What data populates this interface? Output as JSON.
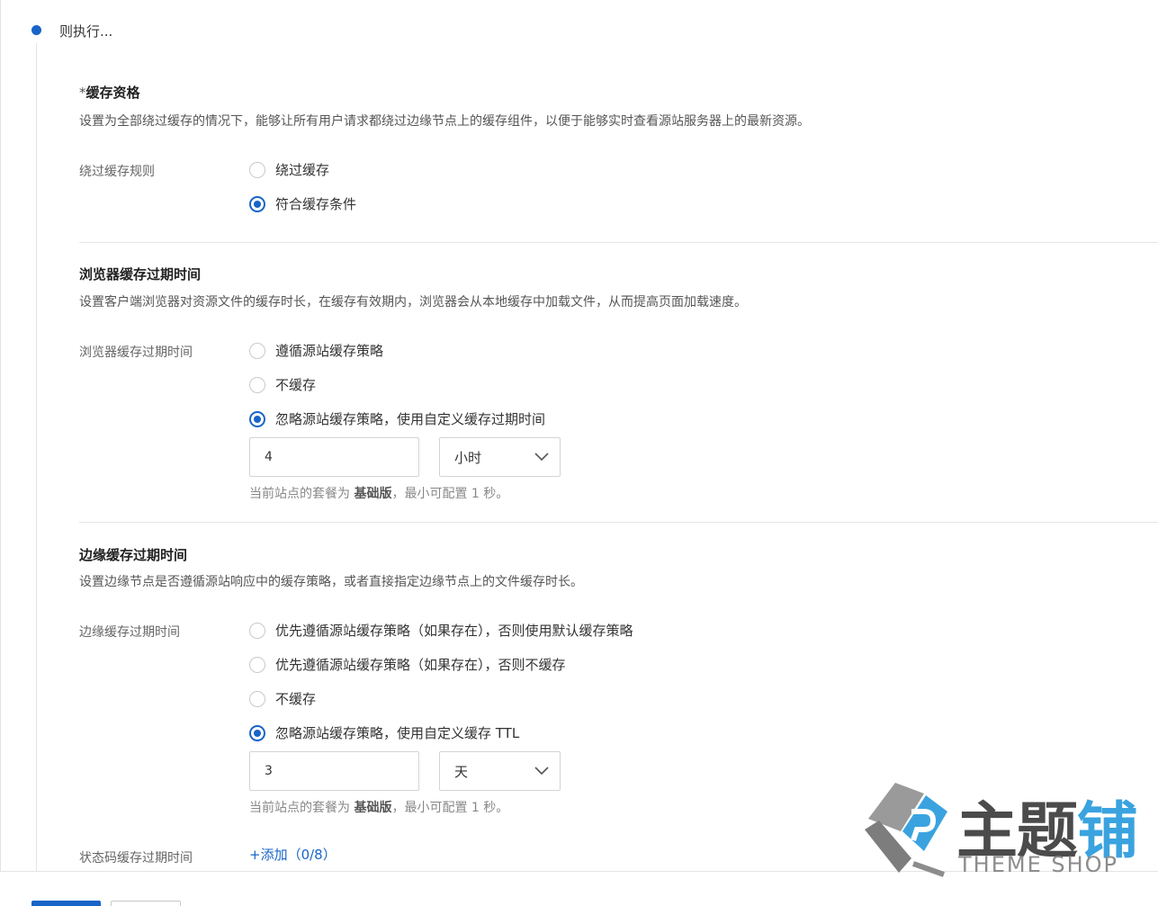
{
  "step": {
    "title": "则执行..."
  },
  "caching_eligibility": {
    "required_mark": "*",
    "title": "缓存资格",
    "description": "设置为全部绕过缓存的情况下，能够让所有用户请求都绕过边缘节点上的缓存组件，以便于能够实时查看源站服务器上的最新资源。",
    "field_label": "绕过缓存规则",
    "options": [
      {
        "label": "绕过缓存",
        "checked": false
      },
      {
        "label": "符合缓存条件",
        "checked": true
      }
    ]
  },
  "browser_ttl": {
    "title": "浏览器缓存过期时间",
    "description": "设置客户端浏览器对资源文件的缓存时长，在缓存有效期内，浏览器会从本地缓存中加载文件，从而提高页面加载速度。",
    "field_label": "浏览器缓存过期时间",
    "options": [
      {
        "label": "遵循源站缓存策略",
        "checked": false
      },
      {
        "label": "不缓存",
        "checked": false
      },
      {
        "label": "忽略源站缓存策略，使用自定义缓存过期时间",
        "checked": true
      }
    ],
    "value": "4",
    "unit": "小时",
    "hint_prefix": "当前站点的套餐为 ",
    "hint_plan": "基础版",
    "hint_suffix": "，最小可配置 1 秒。"
  },
  "edge_ttl": {
    "title": "边缘缓存过期时间",
    "description": "设置边缘节点是否遵循源站响应中的缓存策略，或者直接指定边缘节点上的文件缓存时长。",
    "field_label": "边缘缓存过期时间",
    "options": [
      {
        "label": "优先遵循源站缓存策略（如果存在），否则使用默认缓存策略",
        "checked": false
      },
      {
        "label": "优先遵循源站缓存策略（如果存在），否则不缓存",
        "checked": false
      },
      {
        "label": "不缓存",
        "checked": false
      },
      {
        "label": "忽略源站缓存策略，使用自定义缓存 TTL",
        "checked": true
      }
    ],
    "value": "3",
    "unit": "天",
    "hint_prefix": "当前站点的套餐为 ",
    "hint_plan": "基础版",
    "hint_suffix": "，最小可配置 1 秒。"
  },
  "status_code_ttl": {
    "field_label": "状态码缓存过期时间",
    "add_link": "+添加（0/8）"
  },
  "watermark": {
    "text_main_1": "主题",
    "text_main_2": "铺",
    "text_sub": "THEME SHOP"
  },
  "colors": {
    "accent": "#1864c8"
  },
  "icons": {
    "select_arrow": "chevron-down-icon",
    "radio": "radio-circle"
  }
}
